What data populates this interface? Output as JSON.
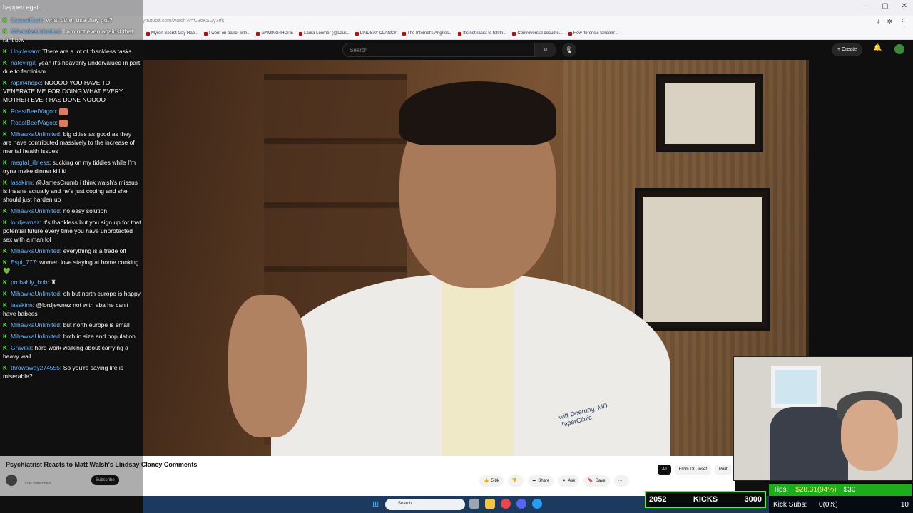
{
  "browser": {
    "url": "youtube.com/watch?v=C3cKSGy7rfs",
    "bookmarks": [
      "Myron Secret Gay Rab...",
      "I went on patrol with...",
      "GAMING4HOPE",
      "Laura Loomer (@Laur...",
      "LINDSAY CLANCY",
      "The Internet's Angries...",
      "It's not racist to tell th...",
      "Controversial docume...",
      "How 'forensic fandom'..."
    ],
    "window_controls": [
      "—",
      "▢",
      "✕"
    ]
  },
  "youtube": {
    "search_placeholder": "Search",
    "create_label": "Create",
    "video_title": "Psychiatrist Reacts to Matt Walsh's Lindsay Clancy Comments",
    "channel_subs": "279k subscribers",
    "subscribe_label": "Subscribe",
    "coat_text_line1": "witt-Doerring, MD",
    "coat_text_line2": "TaperClinic",
    "actions": [
      {
        "icon": "👍",
        "label": "5.8k"
      },
      {
        "icon": "👎",
        "label": ""
      },
      {
        "icon": "➦",
        "label": "Share"
      },
      {
        "icon": "✦",
        "label": "Ask"
      },
      {
        "icon": "🔖",
        "label": "Save"
      },
      {
        "icon": "⋯",
        "label": ""
      }
    ],
    "chips": [
      {
        "label": "All",
        "active": true
      },
      {
        "label": "From Dr. Josef",
        "active": false
      },
      {
        "label": "Polit",
        "active": false
      }
    ]
  },
  "taskbar": {
    "search_placeholder": "Search"
  },
  "chat": {
    "top_line": "happen again",
    "messages": [
      {
        "user": "CasualGurk",
        "text": "what other use they got?"
      },
      {
        "user": "MihawkaUnlimited",
        "text": "I am not even against that rant btw"
      },
      {
        "user": "Unjclesam",
        "text": "There are a lot of thankless tasks"
      },
      {
        "user": "natevirgil",
        "text": "yeah it's heavenly undervalued in part due to feminism"
      },
      {
        "user": "rapin4hope",
        "text": "NOOOO YOU HAVE TO VENERATE ME FOR DOING WHAT EVERY MOTHER EVER HAS DONE NOOOO"
      },
      {
        "user": "RoastBeefVagoo",
        "text": ""
      },
      {
        "user": "RoastBeefVagoo",
        "text": ""
      },
      {
        "user": "MihawkaUnlimited",
        "text": "big cities as good as they are have contributed massively to the increase of mental health issues"
      },
      {
        "user": "megtal_illness",
        "text": "sucking on my tiddies while I'm tryna make dinner kill it!"
      },
      {
        "user": "lasskinn",
        "text": "@JamesCrumb i think walsh's missus is insane actually and he's just coping and she should just harden up"
      },
      {
        "user": "MihawkaUnlimited",
        "text": "no easy solution"
      },
      {
        "user": "lordjewnez",
        "text": "it's thankless but you sign up for that potential future every time you have unprotected sex with a man lol"
      },
      {
        "user": "MihawkaUnlimited",
        "text": "everything is a trade off"
      },
      {
        "user": "Espi_777",
        "text": "women love staying at home cooking 💚"
      },
      {
        "user": "probably_bob",
        "text": "♜"
      },
      {
        "user": "MihawkaUnlimited",
        "text": "oh but north europe is happy"
      },
      {
        "user": "lasskinn",
        "text": "@lordjewnez not with aba he can't have babees"
      },
      {
        "user": "MihawkaUnlimited",
        "text": "but north europe is small"
      },
      {
        "user": "MihawkaUnlimited",
        "text": "both in size and population"
      },
      {
        "user": "Gravilia",
        "text": "hard work walking about carrying a heavy wall"
      },
      {
        "user": "throwaway274555",
        "text": "So you're saying life is miserable?"
      }
    ]
  },
  "kicks": {
    "count": "2052",
    "label": "KICKS",
    "goal": "3000"
  },
  "tips": {
    "tips_label": "Tips:",
    "tips_amount": "$28.31(94%)",
    "tips_goal": "$30",
    "subs_label": "Kick Subs:",
    "subs_value": "0(0%)",
    "subs_goal": "10"
  },
  "colors": {
    "kick_green": "#53fc18",
    "chat_user": "#6ab7ff",
    "youtube_bg": "#0f0f0f"
  }
}
